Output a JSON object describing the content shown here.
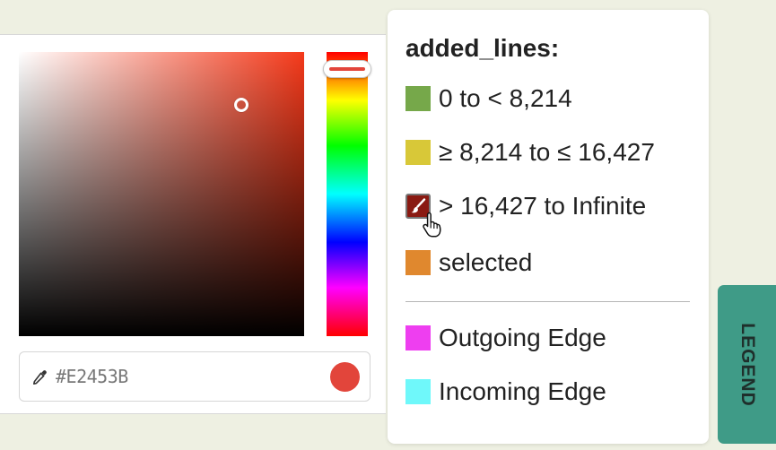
{
  "color_picker": {
    "hex_value": "#E2453B",
    "selected_color": "#e2453b",
    "hue_color": "#f5391a",
    "icons": {
      "eyedropper": "eyedropper-icon"
    }
  },
  "legend": {
    "title": "added_lines:",
    "items": [
      {
        "label": "0 to < 8,214",
        "color": "#76a84a"
      },
      {
        "label": "≥ 8,214 to ≤ 16,427",
        "color": "#d8c838"
      },
      {
        "label": "> 16,427 to Infinite",
        "color": "#8a1a12",
        "icon": "paintbrush-icon"
      },
      {
        "label": "selected",
        "color": "#e0882e"
      }
    ],
    "edge_items": [
      {
        "label": "Outgoing Edge",
        "color": "#ee3ef0"
      },
      {
        "label": "Incoming Edge",
        "color": "#6ff8fa"
      }
    ],
    "tab_label": "LEGEND",
    "tab_color": "#3f9b87"
  },
  "cursor": "pointer-hand-icon"
}
